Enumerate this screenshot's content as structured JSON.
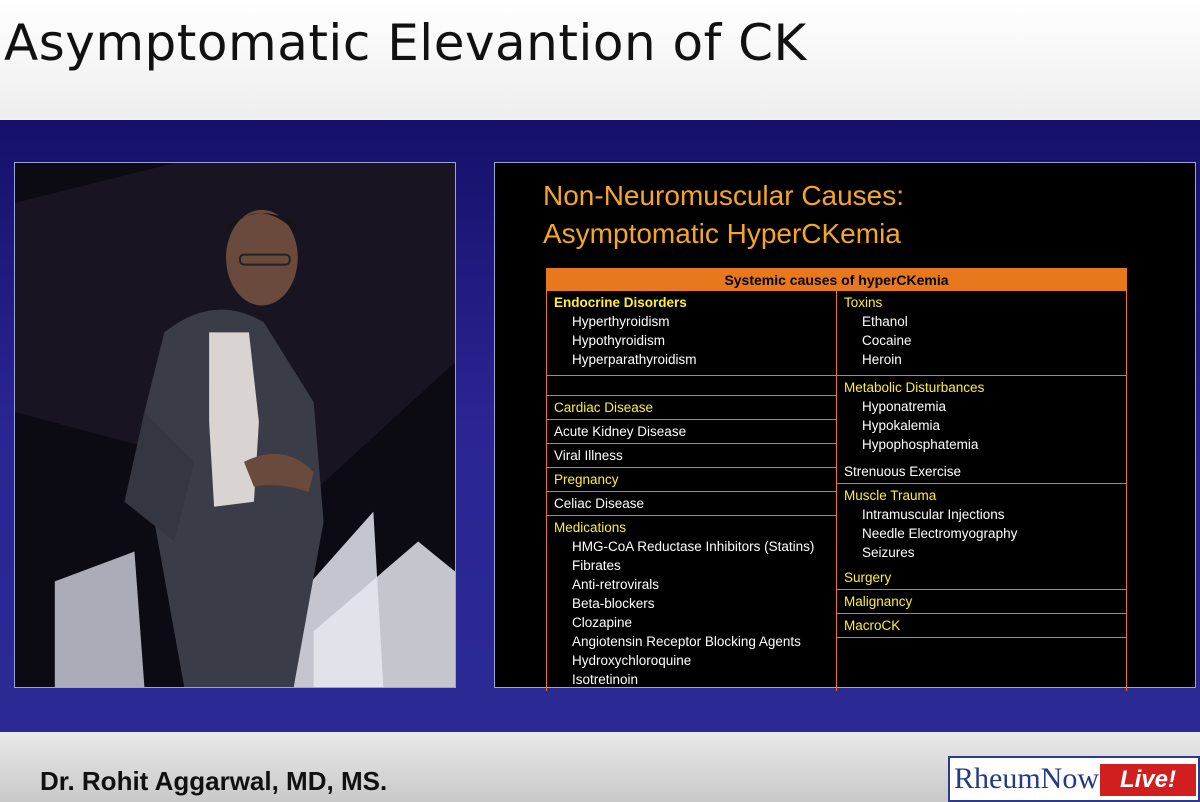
{
  "page_title": "Asymptomatic Elevantion of CK",
  "slide": {
    "title_line1": "Non-Neuromuscular Causes:",
    "title_line2": "Asymptomatic HyperCKemia",
    "table_header": "Systemic causes of hyperCKemia",
    "left": {
      "endocrine": {
        "label": "Endocrine Disorders",
        "items": [
          "Hyperthyroidism",
          "Hypothyroidism",
          "Hyperparathyroidism"
        ]
      },
      "cardiac": "Cardiac Disease",
      "aki": "Acute Kidney Disease",
      "viral": "Viral Illness",
      "pregnancy": "Pregnancy",
      "celiac": "Celiac Disease",
      "medications": {
        "label": "Medications",
        "items": [
          "HMG-CoA Reductase Inhibitors (Statins)",
          "Fibrates",
          "Anti-retrovirals",
          "Beta-blockers",
          "Clozapine",
          "Angiotensin Receptor Blocking Agents",
          "Hydroxychloroquine",
          "Isotretinoin"
        ]
      }
    },
    "right": {
      "toxins": {
        "label": "Toxins",
        "items": [
          "Ethanol",
          "Cocaine",
          "Heroin"
        ]
      },
      "metabolic": {
        "label": "Metabolic Disturbances",
        "items": [
          "Hyponatremia",
          "Hypokalemia",
          "Hypophosphatemia"
        ]
      },
      "exercise": "Strenuous Exercise",
      "trauma": {
        "label": "Muscle Trauma",
        "items": [
          "Intramuscular Injections",
          "Needle Electromyography",
          "Seizures"
        ]
      },
      "surgery": "Surgery",
      "malignancy": "Malignancy",
      "macrock": "MacroCK"
    }
  },
  "speaker": {
    "name": "Dr. Rohit Aggarwal, MD, MS."
  },
  "logo": {
    "brand": "RheumNow",
    "live": "Live!"
  },
  "colors": {
    "accent_orange": "#e8781e",
    "title_orange": "#f5a623",
    "highlight_yellow": "#ffee33",
    "stage_blue": "#2a2592"
  }
}
